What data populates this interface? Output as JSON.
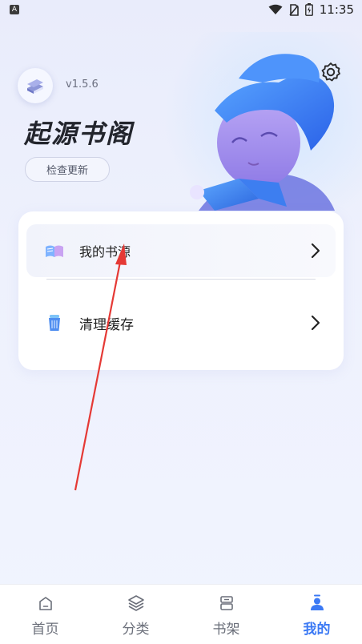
{
  "status_bar": {
    "time": "11:35"
  },
  "header": {
    "version": "v1.5.6",
    "app_title": "起源书阁",
    "check_update_label": "检查更新"
  },
  "menu": {
    "items": [
      {
        "label": "我的书源",
        "icon": "book-icon"
      },
      {
        "label": "清理缓存",
        "icon": "trash-icon"
      }
    ]
  },
  "tabbar": {
    "tabs": [
      {
        "label": "首页",
        "icon": "home-icon"
      },
      {
        "label": "分类",
        "icon": "layers-icon"
      },
      {
        "label": "书架",
        "icon": "bookshelf-icon"
      },
      {
        "label": "我的",
        "icon": "profile-icon",
        "active": true
      }
    ]
  },
  "colors": {
    "accent": "#3b79f4",
    "annotation_arrow": "#e53935"
  }
}
